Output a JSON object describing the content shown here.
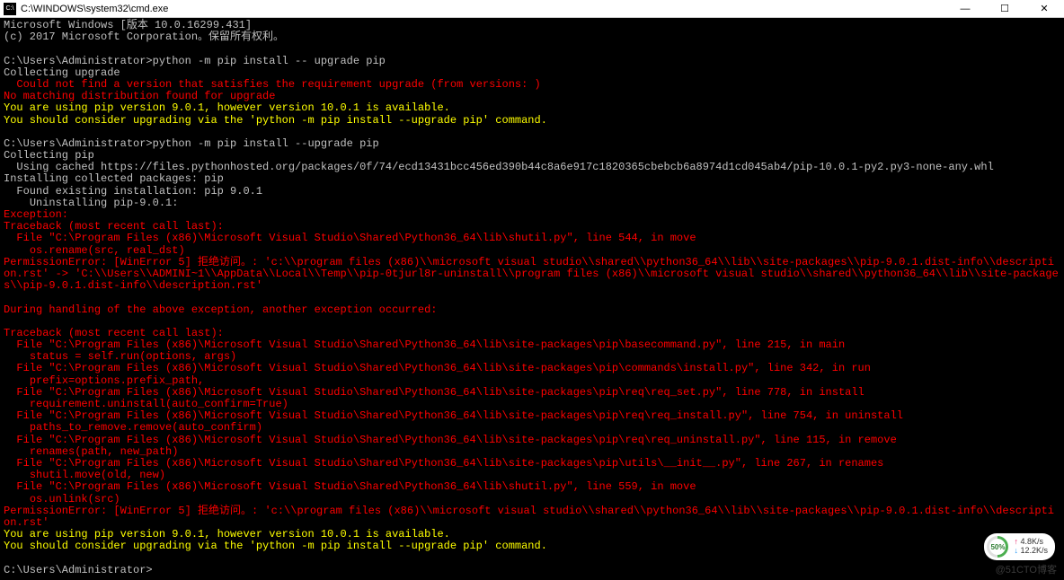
{
  "window": {
    "title": "C:\\WINDOWS\\system32\\cmd.exe"
  },
  "lines": [
    {
      "cls": "white",
      "text": "Microsoft Windows [版本 10.0.16299.431]"
    },
    {
      "cls": "white",
      "text": "(c) 2017 Microsoft Corporation。保留所有权利。"
    },
    {
      "cls": "white",
      "text": ""
    },
    {
      "cls": "white",
      "text": "C:\\Users\\Administrator>python -m pip install -- upgrade pip"
    },
    {
      "cls": "white",
      "text": "Collecting upgrade"
    },
    {
      "cls": "red",
      "text": "  Could not find a version that satisfies the requirement upgrade (from versions: )"
    },
    {
      "cls": "red",
      "text": "No matching distribution found for upgrade"
    },
    {
      "cls": "yellow",
      "text": "You are using pip version 9.0.1, however version 10.0.1 is available."
    },
    {
      "cls": "yellow",
      "text": "You should consider upgrading via the 'python -m pip install --upgrade pip' command."
    },
    {
      "cls": "white",
      "text": ""
    },
    {
      "cls": "white",
      "text": "C:\\Users\\Administrator>python -m pip install --upgrade pip"
    },
    {
      "cls": "white",
      "text": "Collecting pip"
    },
    {
      "cls": "white",
      "text": "  Using cached https://files.pythonhosted.org/packages/0f/74/ecd13431bcc456ed390b44c8a6e917c1820365cbebcb6a8974d1cd045ab4/pip-10.0.1-py2.py3-none-any.whl"
    },
    {
      "cls": "white",
      "text": "Installing collected packages: pip"
    },
    {
      "cls": "white",
      "text": "  Found existing installation: pip 9.0.1"
    },
    {
      "cls": "white",
      "text": "    Uninstalling pip-9.0.1:"
    },
    {
      "cls": "red",
      "text": "Exception:"
    },
    {
      "cls": "red",
      "text": "Traceback (most recent call last):"
    },
    {
      "cls": "red",
      "text": "  File \"C:\\Program Files (x86)\\Microsoft Visual Studio\\Shared\\Python36_64\\lib\\shutil.py\", line 544, in move"
    },
    {
      "cls": "red",
      "text": "    os.rename(src, real_dst)"
    },
    {
      "cls": "red",
      "text": "PermissionError: [WinError 5] 拒绝访问。: 'c:\\\\program files (x86)\\\\microsoft visual studio\\\\shared\\\\python36_64\\\\lib\\\\site-packages\\\\pip-9.0.1.dist-info\\\\description.rst' -> 'C:\\\\Users\\\\ADMINI~1\\\\AppData\\\\Local\\\\Temp\\\\pip-0tjurl8r-uninstall\\\\program files (x86)\\\\microsoft visual studio\\\\shared\\\\python36_64\\\\lib\\\\site-packages\\\\pip-9.0.1.dist-info\\\\description.rst'"
    },
    {
      "cls": "red",
      "text": ""
    },
    {
      "cls": "red",
      "text": "During handling of the above exception, another exception occurred:"
    },
    {
      "cls": "red",
      "text": ""
    },
    {
      "cls": "red",
      "text": "Traceback (most recent call last):"
    },
    {
      "cls": "red",
      "text": "  File \"C:\\Program Files (x86)\\Microsoft Visual Studio\\Shared\\Python36_64\\lib\\site-packages\\pip\\basecommand.py\", line 215, in main"
    },
    {
      "cls": "red",
      "text": "    status = self.run(options, args)"
    },
    {
      "cls": "red",
      "text": "  File \"C:\\Program Files (x86)\\Microsoft Visual Studio\\Shared\\Python36_64\\lib\\site-packages\\pip\\commands\\install.py\", line 342, in run"
    },
    {
      "cls": "red",
      "text": "    prefix=options.prefix_path,"
    },
    {
      "cls": "red",
      "text": "  File \"C:\\Program Files (x86)\\Microsoft Visual Studio\\Shared\\Python36_64\\lib\\site-packages\\pip\\req\\req_set.py\", line 778, in install"
    },
    {
      "cls": "red",
      "text": "    requirement.uninstall(auto_confirm=True)"
    },
    {
      "cls": "red",
      "text": "  File \"C:\\Program Files (x86)\\Microsoft Visual Studio\\Shared\\Python36_64\\lib\\site-packages\\pip\\req\\req_install.py\", line 754, in uninstall"
    },
    {
      "cls": "red",
      "text": "    paths_to_remove.remove(auto_confirm)"
    },
    {
      "cls": "red",
      "text": "  File \"C:\\Program Files (x86)\\Microsoft Visual Studio\\Shared\\Python36_64\\lib\\site-packages\\pip\\req\\req_uninstall.py\", line 115, in remove"
    },
    {
      "cls": "red",
      "text": "    renames(path, new_path)"
    },
    {
      "cls": "red",
      "text": "  File \"C:\\Program Files (x86)\\Microsoft Visual Studio\\Shared\\Python36_64\\lib\\site-packages\\pip\\utils\\__init__.py\", line 267, in renames"
    },
    {
      "cls": "red",
      "text": "    shutil.move(old, new)"
    },
    {
      "cls": "red",
      "text": "  File \"C:\\Program Files (x86)\\Microsoft Visual Studio\\Shared\\Python36_64\\lib\\shutil.py\", line 559, in move"
    },
    {
      "cls": "red",
      "text": "    os.unlink(src)"
    },
    {
      "cls": "red",
      "text": "PermissionError: [WinError 5] 拒绝访问。: 'c:\\\\program files (x86)\\\\microsoft visual studio\\\\shared\\\\python36_64\\\\lib\\\\site-packages\\\\pip-9.0.1.dist-info\\\\description.rst'"
    },
    {
      "cls": "yellow",
      "text": "You are using pip version 9.0.1, however version 10.0.1 is available."
    },
    {
      "cls": "yellow",
      "text": "You should consider upgrading via the 'python -m pip install --upgrade pip' command."
    },
    {
      "cls": "white",
      "text": ""
    },
    {
      "cls": "white",
      "text": "C:\\Users\\Administrator>"
    }
  ],
  "widget": {
    "percent": "50%",
    "up": "4.8K/s",
    "down": "12.2K/s"
  },
  "watermark": "@51CTO博客"
}
